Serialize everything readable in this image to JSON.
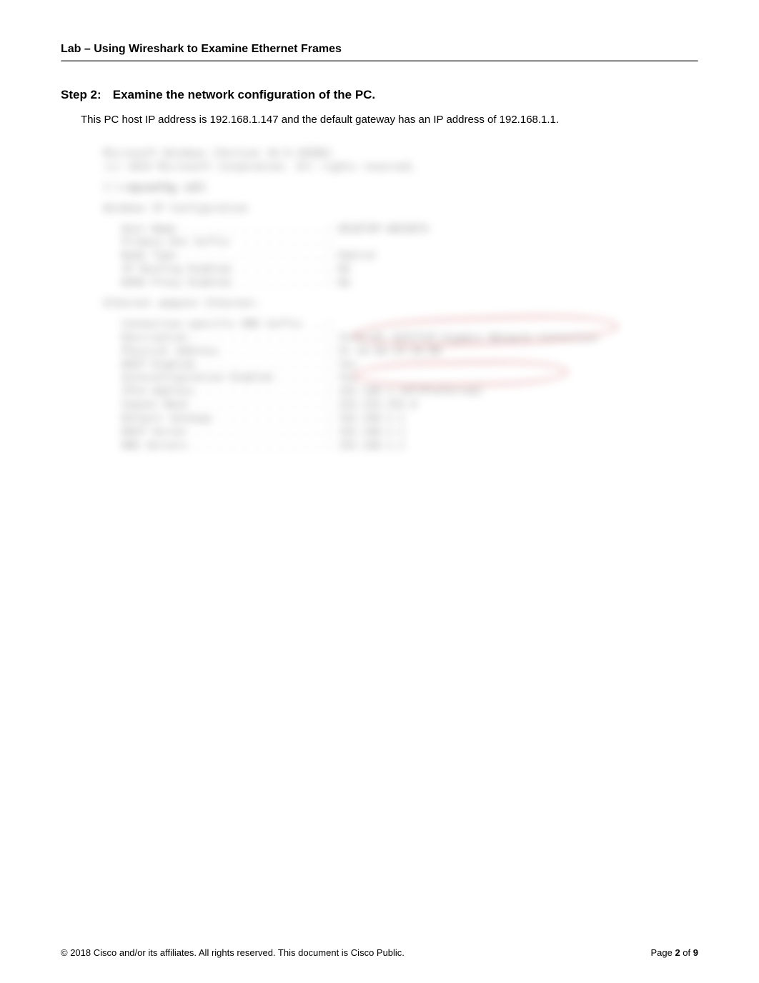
{
  "header": {
    "title": "Lab – Using Wireshark to Examine Ethernet Frames"
  },
  "step": {
    "label": "Step 2:",
    "title": "Examine the network configuration of the PC."
  },
  "body": {
    "text": "This PC host IP address is 192.168.1.147 and the default gateway has an IP address of 192.168.1.1."
  },
  "cmd": {
    "line1": "Microsoft Windows [Version 10.0.10586]",
    "line2": "(c) 2015 Microsoft Corporation. All rights reserved.",
    "prompt_line": "C:\\>",
    "prompt_command": "ipconfig /all",
    "section1_title": "Windows IP Configuration",
    "section1_row1_label": "   Host Name . . . . . . . . . . . . :",
    "section1_row1_value": " DESKTOP-ABCDEFG",
    "section1_row2_label": "   Primary Dns Suffix  . . . . . . . :",
    "section1_row2_value": "",
    "section1_row3_label": "   Node Type . . . . . . . . . . . . :",
    "section1_row3_value": " Hybrid",
    "section1_row4_label": "   IP Routing Enabled. . . . . . . . :",
    "section1_row4_value": " No",
    "section1_row5_label": "   WINS Proxy Enabled. . . . . . . . :",
    "section1_row5_value": " No",
    "section2_title": "Ethernet adapter Ethernet:",
    "section2_row1_label": "   Connection-specific DNS Suffix  . :",
    "section2_row1_value": "",
    "section2_row2_label": "   Description . . . . . . . . . . . :",
    "section2_row2_value": " Intel(R) 82577LM Gigabit Network Connection",
    "section2_row3_label": "   Physical Address. . . . . . . . . :",
    "section2_row3_value": " 5C-26-0A-24-2A-00",
    "section2_row4_label": "   DHCP Enabled. . . . . . . . . . . :",
    "section2_row4_value": " Yes",
    "section2_row5_label": "   Autoconfiguration Enabled . . . . :",
    "section2_row5_value": " Yes",
    "section2_row6_label": "   IPv4 Address. . . . . . . . . . . :",
    "section2_row6_value": " 192.168.1.147(Preferred)",
    "section2_row7_label": "   Subnet Mask . . . . . . . . . . . :",
    "section2_row7_value": " 255.255.255.0",
    "section2_row8_label": "   Default Gateway . . . . . . . . . :",
    "section2_row8_value": " 192.168.1.1",
    "section2_row9_label": "   DHCP Server . . . . . . . . . . . :",
    "section2_row9_value": " 192.168.1.1",
    "section2_row10_label": "   DNS Servers . . . . . . . . . . . :",
    "section2_row10_value": " 192.168.1.1"
  },
  "footer": {
    "copyright": "© 2018 Cisco and/or its affiliates. All rights reserved. This document is Cisco Public.",
    "page_prefix": "Page ",
    "page_current": "2",
    "page_of": " of ",
    "page_total": "9"
  }
}
